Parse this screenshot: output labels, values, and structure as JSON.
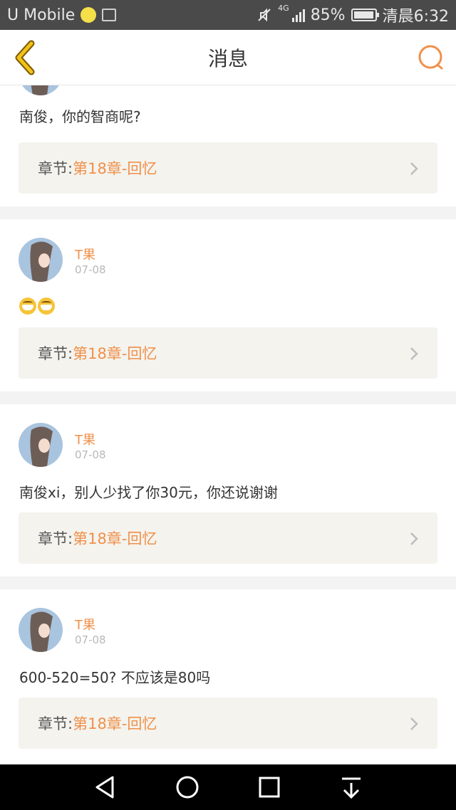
{
  "status_bar": {
    "carrier": "U Mobile",
    "network": "4G",
    "battery": "85%",
    "time": "清晨6:32"
  },
  "header": {
    "title": "消息",
    "back_icon": "chevron-left-icon",
    "search_icon": "search-icon"
  },
  "messages": [
    {
      "text": "南俊，你的智商呢?",
      "chapter_label": "章节:",
      "chapter_name": "第18章-回忆"
    },
    {
      "user": "T果",
      "date": "07-08",
      "text": "",
      "chapter_label": "章节:",
      "chapter_name": "第18章-回忆"
    },
    {
      "user": "T果",
      "date": "07-08",
      "text": "南俊xi，别人少找了你30元，你还说谢谢",
      "chapter_label": "章节:",
      "chapter_name": "第18章-回忆"
    },
    {
      "user": "T果",
      "date": "07-08",
      "text": "600-520=50? 不应该是80吗",
      "chapter_label": "章节:",
      "chapter_name": "第18章-回忆"
    }
  ],
  "colors": {
    "accent": "#f0904a",
    "back_icon": "#d9a400",
    "statusbar_bg": "#4a4a4a",
    "chapter_bg": "#f4f3ee"
  },
  "bottom_nav": [
    "back-triangle-icon",
    "home-circle-icon",
    "recents-square-icon",
    "notification-pull-icon"
  ]
}
